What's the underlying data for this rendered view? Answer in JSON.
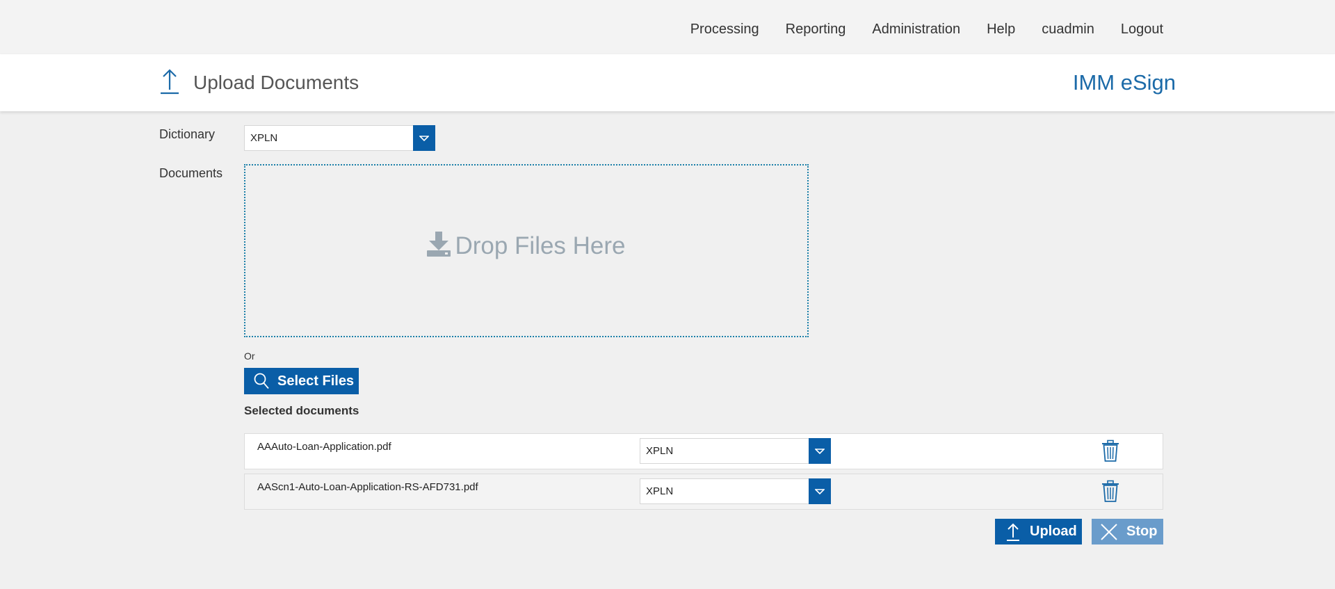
{
  "nav": {
    "items": [
      "Processing",
      "Reporting",
      "Administration",
      "Help",
      "cuadmin",
      "Logout"
    ]
  },
  "header": {
    "title": "Upload Documents",
    "brand": "IMM eSign"
  },
  "form": {
    "dictionary_label": "Dictionary",
    "dictionary_value": "XPLN",
    "documents_label": "Documents",
    "dropzone_text": "Drop Files Here",
    "or_text": "Or",
    "select_files_label": "Select Files"
  },
  "selected": {
    "title": "Selected documents",
    "rows": [
      {
        "filename": "AAAuto-Loan-Application.pdf",
        "dictionary": "XPLN"
      },
      {
        "filename": "AAScn1-Auto-Loan-Application-RS-AFD731.pdf",
        "dictionary": "XPLN"
      }
    ]
  },
  "actions": {
    "upload_label": "Upload",
    "stop_label": "Stop"
  },
  "colors": {
    "accent": "#0a5ea7",
    "brand": "#1b6aa8",
    "stop_disabled": "#6a9ccb"
  }
}
